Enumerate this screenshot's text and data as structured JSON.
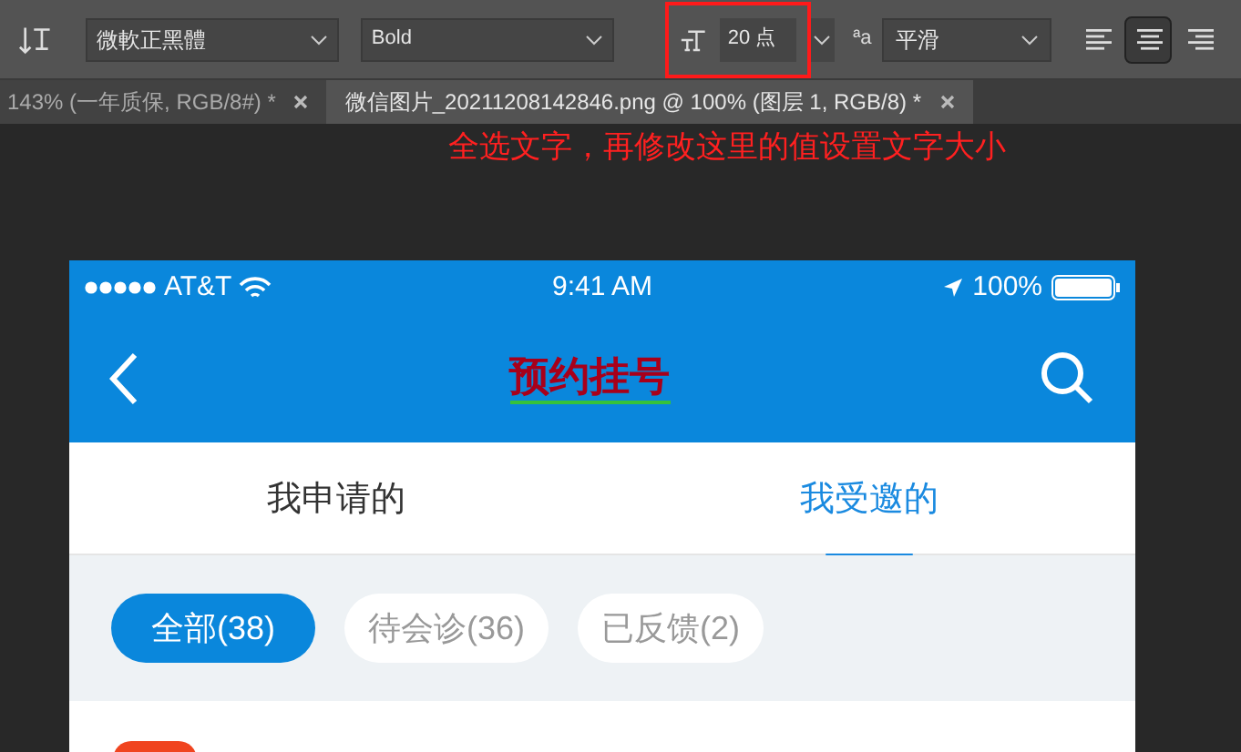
{
  "options_bar": {
    "font_family": "微軟正黑體",
    "font_style": "Bold",
    "font_size": "20 点",
    "anti_alias_icon": "ªa",
    "anti_alias": "平滑",
    "align": [
      {
        "selected": false
      },
      {
        "selected": true
      },
      {
        "selected": false
      }
    ]
  },
  "doc_tabs": [
    {
      "title": "143% (一年质保, RGB/8#) *",
      "selected": false
    },
    {
      "title": "微信图片_20211208142846.png @ 100% (图层 1, RGB/8) *",
      "selected": true
    }
  ],
  "annotation": "全选文字，再修改这里的值设置文字大小",
  "phone": {
    "status_bar": {
      "carrier": "AT&T",
      "time": "9:41 AM",
      "battery": "100%"
    },
    "title": "预约挂号",
    "tabs": [
      {
        "label": "我申请的",
        "selected": false
      },
      {
        "label": "我受邀的",
        "selected": true
      }
    ],
    "filters": [
      {
        "label": "全部(38)",
        "selected": true
      },
      {
        "label": "待会诊(36)",
        "selected": false
      },
      {
        "label": "已反馈(2)",
        "selected": false
      }
    ]
  }
}
